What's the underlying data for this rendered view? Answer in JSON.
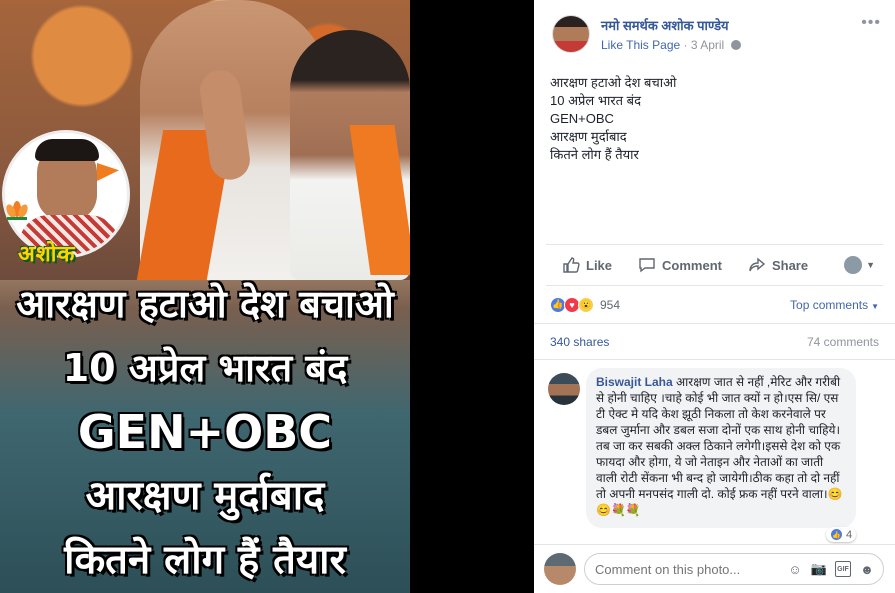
{
  "photo": {
    "badge_name": "अशोक",
    "lines": [
      "आरक्षण हटाओ देश बचाओ",
      "10 अप्रेल भारत बंद",
      "GEN+OBC",
      "आरक्षण मुर्दाबाद",
      "कितने लोग हैं तैयार"
    ]
  },
  "post": {
    "page_name": "नमो समर्थक अशोक पाण्डेय",
    "like_page": "Like This Page",
    "separator": "·",
    "date": "3 April",
    "more_icon": "ellipsis-icon",
    "text_lines": [
      "आरक्षण हटाओ देश बचाओ",
      "10 अप्रेल भारत बंद",
      "GEN+OBC",
      "आरक्षण मुर्दाबाद",
      "कितने लोग हैं तैयार"
    ]
  },
  "actions": {
    "like": "Like",
    "comment": "Comment",
    "share": "Share"
  },
  "stats": {
    "reaction_count": "954",
    "sort_label": "Top comments",
    "shares": "340 shares",
    "comments": "74 comments"
  },
  "comment": {
    "author": "Biswajit Laha",
    "text": "आरक्षण जात से नहीं ,मेरिट और गरीबी से होनी चाहिए ।चाहे कोई भी जात क्यों न हो।एस सि/ एस टी ऐक्ट मे यदि केश झूठी निकला तो केश करनेवाले पर डबल जुर्माना और डबल सजा दोनों एक साथ होनी चाहिये।तब जा कर सबकी अक्ल ठिकाने लगेगी।इससे देश को एक फायदा और होगा, ये जो नेताइन और नेताओं का जाती वाली रोटी सेंकना भी बन्द हो जायेगी।ठीक कहा तो दो नहीं तो अपनी मनपसंद गाली दो. कोई फ्रक नहीं परने वाला।😊😊💐💐",
    "like_count": "4"
  },
  "composer": {
    "placeholder": "Comment on this photo..."
  },
  "colors": {
    "link": "#365899",
    "accent": "#4267b2",
    "muted": "#90949c"
  }
}
